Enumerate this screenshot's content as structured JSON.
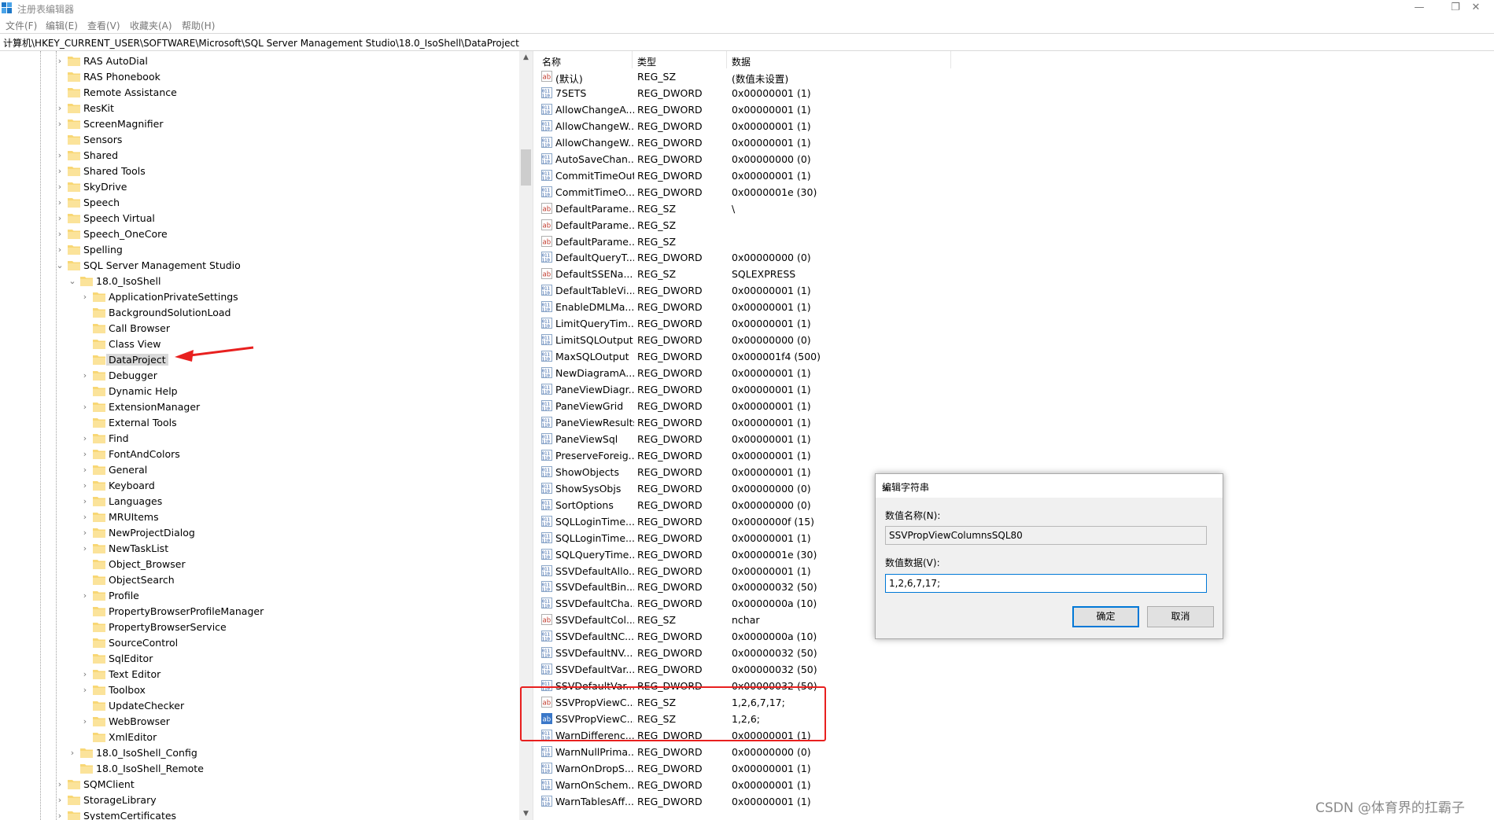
{
  "window": {
    "title": "注册表编辑器",
    "buttons": {
      "minimize": "—",
      "restore": "❐",
      "close": "✕"
    }
  },
  "menu": [
    "文件(F)",
    "编辑(E)",
    "查看(V)",
    "收藏夹(A)",
    "帮助(H)"
  ],
  "address": "计算机\\HKEY_CURRENT_USER\\SOFTWARE\\Microsoft\\SQL Server Management Studio\\18.0_IsoShell\\DataProject",
  "tree": [
    {
      "label": "RAS AutoDial",
      "level": 0,
      "expandable": true,
      "expanded": false
    },
    {
      "label": "RAS Phonebook",
      "level": 0,
      "expandable": false,
      "expanded": false
    },
    {
      "label": "Remote Assistance",
      "level": 0,
      "expandable": false,
      "expanded": false
    },
    {
      "label": "ResKit",
      "level": 0,
      "expandable": true,
      "expanded": false
    },
    {
      "label": "ScreenMagnifier",
      "level": 0,
      "expandable": true,
      "expanded": false
    },
    {
      "label": "Sensors",
      "level": 0,
      "expandable": false,
      "expanded": false
    },
    {
      "label": "Shared",
      "level": 0,
      "expandable": true,
      "expanded": false
    },
    {
      "label": "Shared Tools",
      "level": 0,
      "expandable": true,
      "expanded": false
    },
    {
      "label": "SkyDrive",
      "level": 0,
      "expandable": true,
      "expanded": false
    },
    {
      "label": "Speech",
      "level": 0,
      "expandable": true,
      "expanded": false
    },
    {
      "label": "Speech Virtual",
      "level": 0,
      "expandable": true,
      "expanded": false
    },
    {
      "label": "Speech_OneCore",
      "level": 0,
      "expandable": true,
      "expanded": false
    },
    {
      "label": "Spelling",
      "level": 0,
      "expandable": true,
      "expanded": false
    },
    {
      "label": "SQL Server Management Studio",
      "level": 0,
      "expandable": true,
      "expanded": true
    },
    {
      "label": "18.0_IsoShell",
      "level": 1,
      "expandable": true,
      "expanded": true
    },
    {
      "label": "ApplicationPrivateSettings",
      "level": 2,
      "expandable": true,
      "expanded": false
    },
    {
      "label": "BackgroundSolutionLoad",
      "level": 2,
      "expandable": false,
      "expanded": false
    },
    {
      "label": "Call Browser",
      "level": 2,
      "expandable": false,
      "expanded": false
    },
    {
      "label": "Class View",
      "level": 2,
      "expandable": false,
      "expanded": false
    },
    {
      "label": "DataProject",
      "level": 2,
      "expandable": false,
      "expanded": false,
      "selected": true
    },
    {
      "label": "Debugger",
      "level": 2,
      "expandable": true,
      "expanded": false
    },
    {
      "label": "Dynamic Help",
      "level": 2,
      "expandable": false,
      "expanded": false
    },
    {
      "label": "ExtensionManager",
      "level": 2,
      "expandable": true,
      "expanded": false
    },
    {
      "label": "External Tools",
      "level": 2,
      "expandable": false,
      "expanded": false
    },
    {
      "label": "Find",
      "level": 2,
      "expandable": true,
      "expanded": false
    },
    {
      "label": "FontAndColors",
      "level": 2,
      "expandable": true,
      "expanded": false
    },
    {
      "label": "General",
      "level": 2,
      "expandable": true,
      "expanded": false
    },
    {
      "label": "Keyboard",
      "level": 2,
      "expandable": true,
      "expanded": false
    },
    {
      "label": "Languages",
      "level": 2,
      "expandable": true,
      "expanded": false
    },
    {
      "label": "MRUItems",
      "level": 2,
      "expandable": true,
      "expanded": false
    },
    {
      "label": "NewProjectDialog",
      "level": 2,
      "expandable": true,
      "expanded": false
    },
    {
      "label": "NewTaskList",
      "level": 2,
      "expandable": true,
      "expanded": false
    },
    {
      "label": "Object_Browser",
      "level": 2,
      "expandable": false,
      "expanded": false
    },
    {
      "label": "ObjectSearch",
      "level": 2,
      "expandable": false,
      "expanded": false
    },
    {
      "label": "Profile",
      "level": 2,
      "expandable": true,
      "expanded": false
    },
    {
      "label": "PropertyBrowserProfileManager",
      "level": 2,
      "expandable": false,
      "expanded": false
    },
    {
      "label": "PropertyBrowserService",
      "level": 2,
      "expandable": false,
      "expanded": false
    },
    {
      "label": "SourceControl",
      "level": 2,
      "expandable": false,
      "expanded": false
    },
    {
      "label": "SqlEditor",
      "level": 2,
      "expandable": false,
      "expanded": false
    },
    {
      "label": "Text Editor",
      "level": 2,
      "expandable": true,
      "expanded": false
    },
    {
      "label": "Toolbox",
      "level": 2,
      "expandable": true,
      "expanded": false
    },
    {
      "label": "UpdateChecker",
      "level": 2,
      "expandable": false,
      "expanded": false
    },
    {
      "label": "WebBrowser",
      "level": 2,
      "expandable": true,
      "expanded": false
    },
    {
      "label": "XmlEditor",
      "level": 2,
      "expandable": false,
      "expanded": false
    },
    {
      "label": "18.0_IsoShell_Config",
      "level": 1,
      "expandable": true,
      "expanded": false
    },
    {
      "label": "18.0_IsoShell_Remote",
      "level": 1,
      "expandable": false,
      "expanded": false
    },
    {
      "label": "SQMClient",
      "level": 0,
      "expandable": true,
      "expanded": false
    },
    {
      "label": "StorageLibrary",
      "level": 0,
      "expandable": true,
      "expanded": false
    },
    {
      "label": "SystemCertificates",
      "level": 0,
      "expandable": true,
      "expanded": false
    }
  ],
  "columns": {
    "name": "名称",
    "type": "类型",
    "data": "数据"
  },
  "values": [
    {
      "name": "(默认)",
      "type": "REG_SZ",
      "data": "(数值未设置)",
      "icon": "string"
    },
    {
      "name": "7SETS",
      "type": "REG_DWORD",
      "data": "0x00000001 (1)",
      "icon": "binary"
    },
    {
      "name": "AllowChangeA...",
      "type": "REG_DWORD",
      "data": "0x00000001 (1)",
      "icon": "binary"
    },
    {
      "name": "AllowChangeW...",
      "type": "REG_DWORD",
      "data": "0x00000001 (1)",
      "icon": "binary"
    },
    {
      "name": "AllowChangeW...",
      "type": "REG_DWORD",
      "data": "0x00000001 (1)",
      "icon": "binary"
    },
    {
      "name": "AutoSaveChan...",
      "type": "REG_DWORD",
      "data": "0x00000000 (0)",
      "icon": "binary"
    },
    {
      "name": "CommitTimeOut",
      "type": "REG_DWORD",
      "data": "0x00000001 (1)",
      "icon": "binary"
    },
    {
      "name": "CommitTimeO...",
      "type": "REG_DWORD",
      "data": "0x0000001e (30)",
      "icon": "binary"
    },
    {
      "name": "DefaultParame...",
      "type": "REG_SZ",
      "data": "\\",
      "icon": "string"
    },
    {
      "name": "DefaultParame...",
      "type": "REG_SZ",
      "data": "",
      "icon": "string"
    },
    {
      "name": "DefaultParame...",
      "type": "REG_SZ",
      "data": "",
      "icon": "string"
    },
    {
      "name": "DefaultQueryT...",
      "type": "REG_DWORD",
      "data": "0x00000000 (0)",
      "icon": "binary"
    },
    {
      "name": "DefaultSSENa...",
      "type": "REG_SZ",
      "data": "SQLEXPRESS",
      "icon": "string"
    },
    {
      "name": "DefaultTableVi...",
      "type": "REG_DWORD",
      "data": "0x00000001 (1)",
      "icon": "binary"
    },
    {
      "name": "EnableDMLMa...",
      "type": "REG_DWORD",
      "data": "0x00000001 (1)",
      "icon": "binary"
    },
    {
      "name": "LimitQueryTim...",
      "type": "REG_DWORD",
      "data": "0x00000001 (1)",
      "icon": "binary"
    },
    {
      "name": "LimitSQLOutput",
      "type": "REG_DWORD",
      "data": "0x00000000 (0)",
      "icon": "binary"
    },
    {
      "name": "MaxSQLOutput",
      "type": "REG_DWORD",
      "data": "0x000001f4 (500)",
      "icon": "binary"
    },
    {
      "name": "NewDiagramA...",
      "type": "REG_DWORD",
      "data": "0x00000001 (1)",
      "icon": "binary"
    },
    {
      "name": "PaneViewDiagr...",
      "type": "REG_DWORD",
      "data": "0x00000001 (1)",
      "icon": "binary"
    },
    {
      "name": "PaneViewGrid",
      "type": "REG_DWORD",
      "data": "0x00000001 (1)",
      "icon": "binary"
    },
    {
      "name": "PaneViewResults",
      "type": "REG_DWORD",
      "data": "0x00000001 (1)",
      "icon": "binary"
    },
    {
      "name": "PaneViewSql",
      "type": "REG_DWORD",
      "data": "0x00000001 (1)",
      "icon": "binary"
    },
    {
      "name": "PreserveForeig...",
      "type": "REG_DWORD",
      "data": "0x00000001 (1)",
      "icon": "binary"
    },
    {
      "name": "ShowObjects",
      "type": "REG_DWORD",
      "data": "0x00000001 (1)",
      "icon": "binary"
    },
    {
      "name": "ShowSysObjs",
      "type": "REG_DWORD",
      "data": "0x00000000 (0)",
      "icon": "binary"
    },
    {
      "name": "SortOptions",
      "type": "REG_DWORD",
      "data": "0x00000000 (0)",
      "icon": "binary"
    },
    {
      "name": "SQLLoginTime...",
      "type": "REG_DWORD",
      "data": "0x0000000f (15)",
      "icon": "binary"
    },
    {
      "name": "SQLLoginTime...",
      "type": "REG_DWORD",
      "data": "0x00000001 (1)",
      "icon": "binary"
    },
    {
      "name": "SQLQueryTime...",
      "type": "REG_DWORD",
      "data": "0x0000001e (30)",
      "icon": "binary"
    },
    {
      "name": "SSVDefaultAllo...",
      "type": "REG_DWORD",
      "data": "0x00000001 (1)",
      "icon": "binary"
    },
    {
      "name": "SSVDefaultBin...",
      "type": "REG_DWORD",
      "data": "0x00000032 (50)",
      "icon": "binary"
    },
    {
      "name": "SSVDefaultCha...",
      "type": "REG_DWORD",
      "data": "0x0000000a (10)",
      "icon": "binary"
    },
    {
      "name": "SSVDefaultCol...",
      "type": "REG_SZ",
      "data": "nchar",
      "icon": "string"
    },
    {
      "name": "SSVDefaultNC...",
      "type": "REG_DWORD",
      "data": "0x0000000a (10)",
      "icon": "binary"
    },
    {
      "name": "SSVDefaultNV...",
      "type": "REG_DWORD",
      "data": "0x00000032 (50)",
      "icon": "binary"
    },
    {
      "name": "SSVDefaultVar...",
      "type": "REG_DWORD",
      "data": "0x00000032 (50)",
      "icon": "binary"
    },
    {
      "name": "SSVDefaultVar...",
      "type": "REG_DWORD",
      "data": "0x00000032 (50)",
      "icon": "binary"
    },
    {
      "name": "SSVPropViewC...",
      "type": "REG_SZ",
      "data": "1,2,6,7,17;",
      "icon": "string"
    },
    {
      "name": "SSVPropViewC...",
      "type": "REG_SZ",
      "data": "1,2,6;",
      "icon": "string-selected"
    },
    {
      "name": "WarnDifferenc...",
      "type": "REG_DWORD",
      "data": "0x00000001 (1)",
      "icon": "binary"
    },
    {
      "name": "WarnNullPrima...",
      "type": "REG_DWORD",
      "data": "0x00000000 (0)",
      "icon": "binary"
    },
    {
      "name": "WarnOnDropS...",
      "type": "REG_DWORD",
      "data": "0x00000001 (1)",
      "icon": "binary"
    },
    {
      "name": "WarnOnSchem...",
      "type": "REG_DWORD",
      "data": "0x00000001 (1)",
      "icon": "binary"
    },
    {
      "name": "WarnTablesAff...",
      "type": "REG_DWORD",
      "data": "0x00000001 (1)",
      "icon": "binary"
    }
  ],
  "dialog": {
    "title": "编辑字符串",
    "name_label": "数值名称(N):",
    "name_value": "SSVPropViewColumnsSQL80",
    "data_label": "数值数据(V):",
    "data_value": "1,2,6,7,17;",
    "ok_label": "确定",
    "cancel_label": "取消",
    "close": "✕"
  },
  "watermark": "CSDN @体育界的扛霸子",
  "colors": {
    "annotation_red": "#e8201f",
    "accent_blue": "#0078d7",
    "folder_yellow": "#f8d775",
    "selection_gray": "#d9d9d9"
  }
}
